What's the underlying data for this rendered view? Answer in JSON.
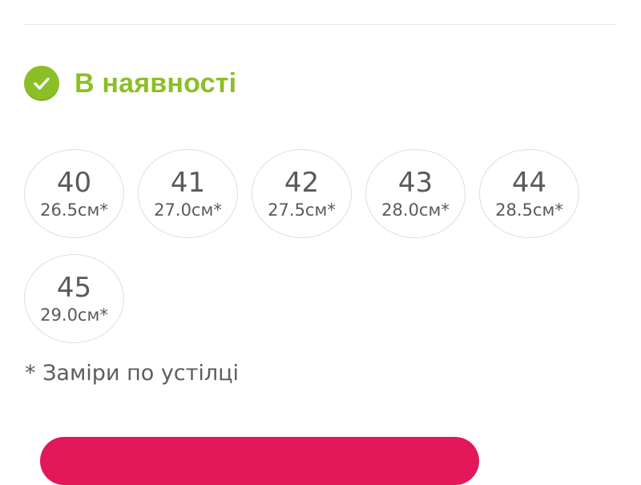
{
  "availability": {
    "label": "В наявності",
    "icon": "check-circle-icon",
    "color": "#8bbf25"
  },
  "sizes": [
    {
      "size": "40",
      "length": "26.5см*"
    },
    {
      "size": "41",
      "length": "27.0см*"
    },
    {
      "size": "42",
      "length": "27.5см*"
    },
    {
      "size": "43",
      "length": "28.0см*"
    },
    {
      "size": "44",
      "length": "28.5см*"
    },
    {
      "size": "45",
      "length": "29.0см*"
    }
  ],
  "note": "* Заміри по устілці",
  "colors": {
    "accent_button": "#e2185a",
    "text": "#5d5d5d",
    "border": "#dedede"
  }
}
